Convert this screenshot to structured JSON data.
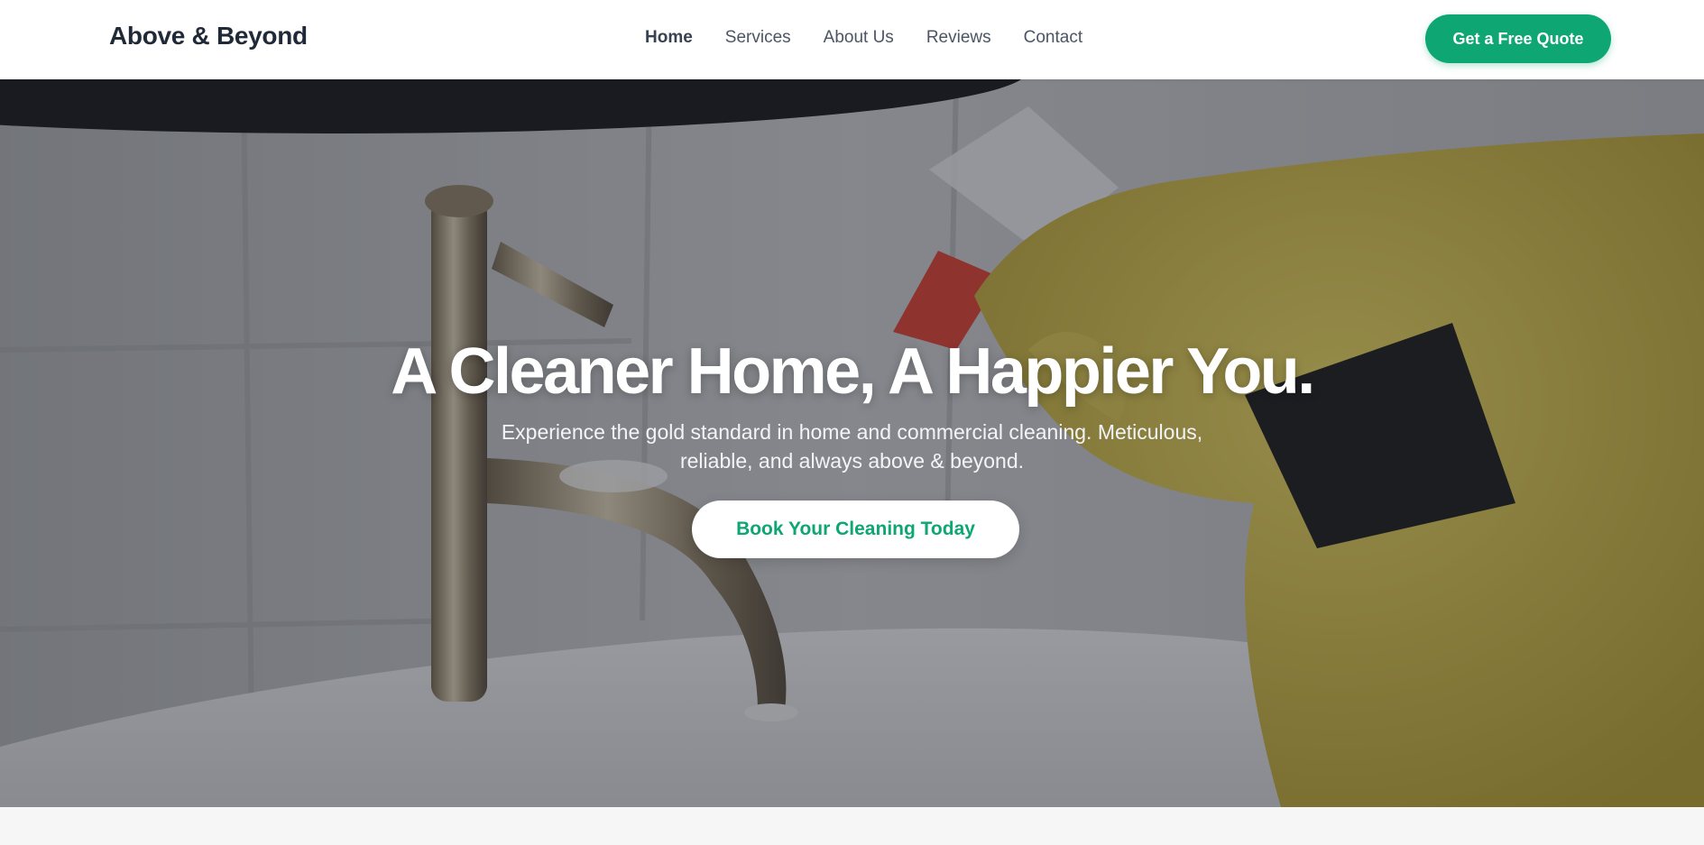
{
  "header": {
    "logo": "Above & Beyond",
    "nav": [
      {
        "label": "Home",
        "active": true
      },
      {
        "label": "Services",
        "active": false
      },
      {
        "label": "About Us",
        "active": false
      },
      {
        "label": "Reviews",
        "active": false
      },
      {
        "label": "Contact",
        "active": false
      }
    ],
    "cta_label": "Get a Free Quote"
  },
  "hero": {
    "title": "A Cleaner Home, A Happier You.",
    "subtitle_line1": "Experience the gold standard in home and commercial cleaning. Meticulous,",
    "subtitle_line2": "reliable, and always above & beyond.",
    "cta_label": "Book Your Cleaning Today",
    "image_subject": "gloved hand spraying cleaner on bathroom faucet"
  },
  "colors": {
    "accent": "#0ea672",
    "text_dark": "#1f2937",
    "nav_text": "#4b5563",
    "white": "#ffffff",
    "glove_yellow": "#c9b63c",
    "spray_red": "#d93a2b"
  }
}
